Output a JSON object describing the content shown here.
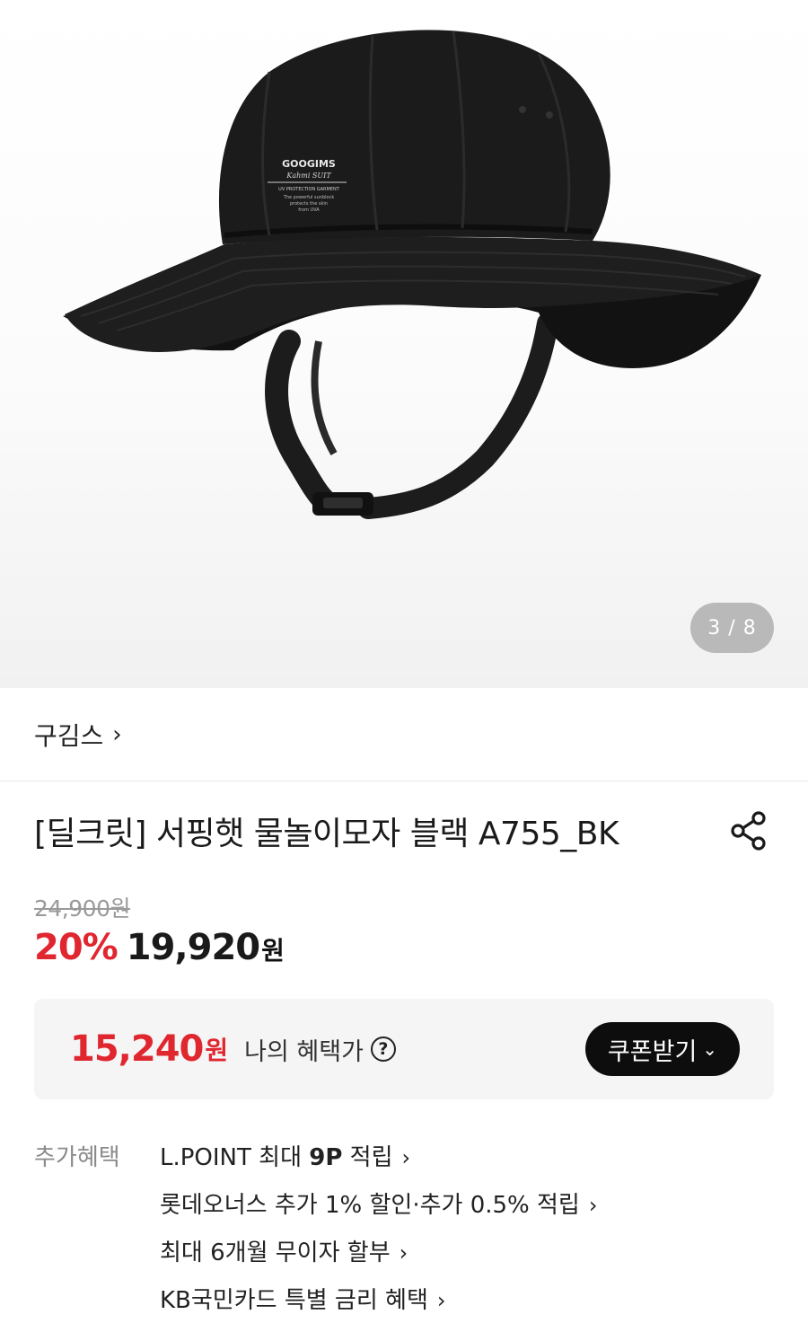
{
  "gallery": {
    "hat_print": {
      "brand": "GOOGIMS",
      "line": "Kahmi SUIT",
      "protection": "UV PROTECTION GARMENT",
      "copy1": "The powerful sunblock",
      "copy2": "protects the skin",
      "copy3": "from UVA"
    },
    "counter": "3 / 8"
  },
  "brand": {
    "name": "구김스",
    "chevron": "›"
  },
  "product": {
    "title": "[딜크릿] 서핑햇 물놀이모자 블랙 A755_BK"
  },
  "price": {
    "original": "24,900원",
    "discount": "20%",
    "sale_amount": "19,920",
    "sale_unit": "원"
  },
  "benefit": {
    "my_price": "15,240",
    "my_unit": "원",
    "label": "나의 혜택가",
    "help": "?",
    "coupon_button": "쿠폰받기",
    "coupon_chevron": "⌄"
  },
  "extra_benefits": {
    "label": "추가혜택",
    "items": [
      {
        "pre": "L.POINT 최대 ",
        "bold": "9P",
        "post": " 적립"
      },
      {
        "pre": "롯데오너스 추가 1% 할인·추가 0.5% 적립",
        "bold": "",
        "post": ""
      },
      {
        "pre": "최대 6개월 무이자 할부",
        "bold": "",
        "post": ""
      },
      {
        "pre": "KB국민카드 특별 금리 혜택",
        "bold": "",
        "post": ""
      }
    ],
    "chevron": "›"
  },
  "colors": {
    "accent_red": "#e0262f",
    "button_black": "#0d0d0d",
    "counter_gray": "#b9b9b9"
  }
}
